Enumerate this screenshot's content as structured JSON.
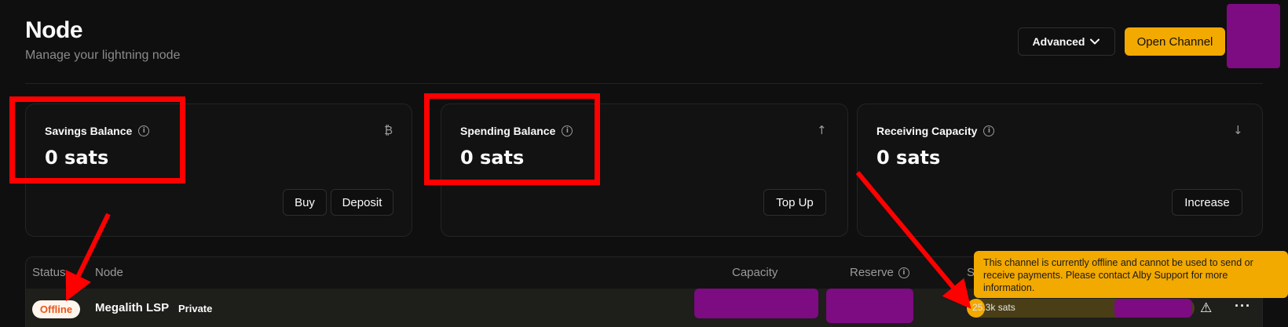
{
  "header": {
    "title": "Node",
    "subtitle": "Manage your lightning node",
    "advanced_label": "Advanced",
    "open_channel_label": "Open Channel"
  },
  "cards": [
    {
      "title": "Savings Balance",
      "value": "0 sats",
      "icon": "bitcoin-icon",
      "icon_glyph": "₿",
      "buttons": [
        "Buy",
        "Deposit"
      ]
    },
    {
      "title": "Spending Balance",
      "value": "0 sats",
      "icon": "arrow-up-icon",
      "icon_glyph": "↑",
      "buttons": [
        "Top Up"
      ]
    },
    {
      "title": "Receiving Capacity",
      "value": "0 sats",
      "icon": "arrow-down-icon",
      "icon_glyph": "↓",
      "buttons": [
        "Increase"
      ]
    }
  ],
  "table": {
    "columns": {
      "status": "Status",
      "node": "Node",
      "capacity": "Capacity",
      "reserve": "Reserve",
      "spending": "S"
    },
    "rows": [
      {
        "status": "Offline",
        "node": "Megalith LSP",
        "tag": "Private",
        "spending_label": "25.3k sats",
        "spending_fraction": 0.08
      }
    ]
  },
  "tooltip": {
    "text": "This channel is currently offline and cannot be used to send or receive payments. Please contact Alby Support for more information."
  },
  "colors": {
    "accent": "#f2a900",
    "annotation": "#ff0000",
    "redaction": "#7d0b82",
    "offline": "#e8571c"
  }
}
